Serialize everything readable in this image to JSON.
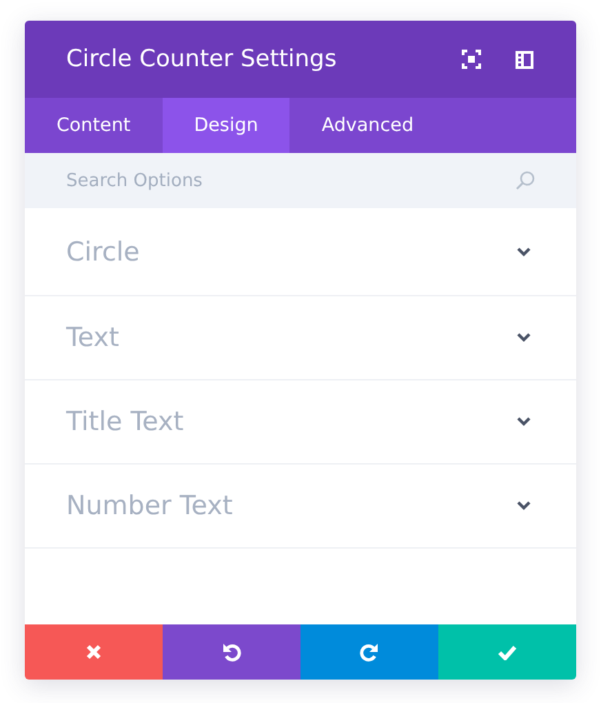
{
  "window": {
    "title": "Circle Counter Settings"
  },
  "tabs": [
    {
      "label": "Content",
      "selected": false
    },
    {
      "label": "Design",
      "selected": true
    },
    {
      "label": "Advanced",
      "selected": false
    }
  ],
  "search": {
    "placeholder": "Search Options"
  },
  "sections": [
    {
      "label": "Circle",
      "expanded": false
    },
    {
      "label": "Text",
      "expanded": false
    },
    {
      "label": "Title Text",
      "expanded": false
    },
    {
      "label": "Number Text",
      "expanded": false
    }
  ],
  "footer_buttons": [
    {
      "kind": "cancel",
      "color": "#f65856"
    },
    {
      "kind": "undo",
      "color": "#7c49cc"
    },
    {
      "kind": "redo",
      "color": "#008bdb"
    },
    {
      "kind": "save",
      "color": "#00c1a9"
    }
  ]
}
